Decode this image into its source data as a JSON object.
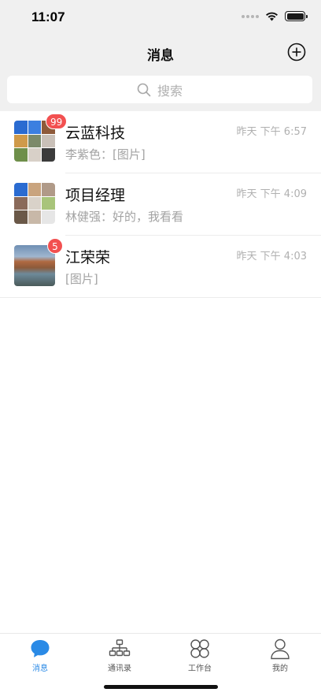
{
  "status_bar": {
    "time": "11:07"
  },
  "nav": {
    "title": "消息",
    "add_icon": "plus-circle-icon"
  },
  "search": {
    "placeholder": "搜索",
    "icon": "search-icon"
  },
  "conversations": [
    {
      "name": "云蓝科技",
      "preview": "李紫色：[图片]",
      "time": "昨天 下午 6:57",
      "badge": "99",
      "avatar": "group-collage"
    },
    {
      "name": "项目经理",
      "preview": "林健强：好的，我看看",
      "time": "昨天 下午 4:09",
      "badge": "",
      "avatar": "group-collage"
    },
    {
      "name": "江荣荣",
      "preview": "[图片]",
      "time": "昨天 下午 4:03",
      "badge": "5",
      "avatar": "landscape-photo"
    }
  ],
  "tabs": [
    {
      "label": "消息",
      "icon": "chat-bubble-icon",
      "active": true
    },
    {
      "label": "通讯录",
      "icon": "org-chart-icon",
      "active": false
    },
    {
      "label": "工作台",
      "icon": "workspace-grid-icon",
      "active": false
    },
    {
      "label": "我的",
      "icon": "person-icon",
      "active": false
    }
  ],
  "colors": {
    "accent": "#2a8ae6",
    "badge": "#f25050",
    "header_bg": "#f0f0f0"
  }
}
